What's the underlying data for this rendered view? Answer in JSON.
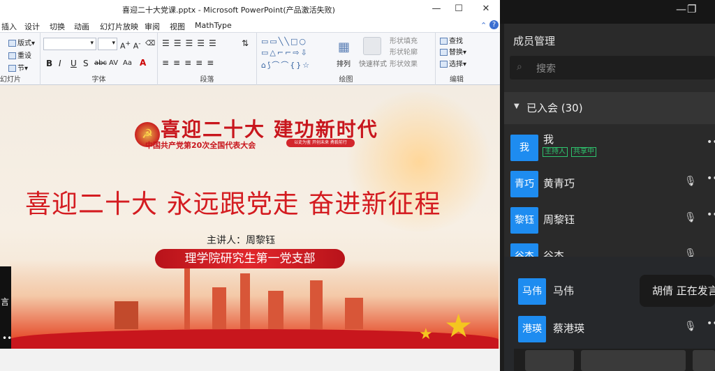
{
  "ppt": {
    "window_title": "喜迎二十大党课.pptx - Microsoft PowerPoint(产品激活失败)",
    "window_controls": {
      "minimize": "—",
      "maximize": "☐",
      "close": "✕"
    },
    "menu": [
      "插入",
      "设计",
      "切换",
      "动画",
      "幻灯片放映",
      "审阅",
      "视图",
      "MathType"
    ],
    "ribbon": {
      "slides_group": {
        "label": "幻灯片",
        "layout": "版式",
        "reset": "重设",
        "section": "节"
      },
      "font_group": {
        "label": "字体",
        "bold": "B",
        "italic": "I",
        "underline": "U",
        "shadow": "S",
        "strike": "abc",
        "spacing": "AV",
        "case": "Aa"
      },
      "paragraph_group": {
        "label": "段落"
      },
      "drawing_group": {
        "label": "绘图",
        "arrange": "排列",
        "quick_styles": "快速样式",
        "shape_fill": "形状填充",
        "shape_outline": "形状轮廓",
        "shape_effects": "形状效果"
      },
      "editing_group": {
        "label": "编辑",
        "find": "查找",
        "replace": "替换",
        "select": "选择"
      }
    },
    "slide": {
      "logo_title": "喜迎二十大 建功新时代",
      "logo_subtitle": "中国共产党第20次全国代表大会",
      "logo_tag": "以史为鉴 开创未来 勇毅前行",
      "headline": "喜迎二十大 永远跟党走 奋进新征程",
      "speaker": "主讲人：周黎钰",
      "org_banner": "理学院研究生第一党支部"
    },
    "left_strip_text": "言"
  },
  "meeting_panel": {
    "title": "成员管理",
    "search_placeholder": "搜索",
    "section_label": "已入会 (30)",
    "members": [
      {
        "avatar": "我",
        "name": "我",
        "tags": [
          "主持人",
          "共享中"
        ],
        "mic": ""
      },
      {
        "avatar": "青巧",
        "name": "黄青巧",
        "tags": [],
        "mic": "🎙"
      },
      {
        "avatar": "黎钰",
        "name": "周黎钰",
        "tags": [],
        "mic": "🎙"
      },
      {
        "avatar": "谷杰",
        "name": "谷杰",
        "tags": [],
        "mic": "🎙"
      },
      {
        "avatar": "马伟",
        "name": "马伟",
        "tags": [],
        "mic": ""
      },
      {
        "avatar": "港瑛",
        "name": "蔡港瑛",
        "tags": [],
        "mic": "🎙"
      }
    ],
    "toast": "胡倩 正在发言",
    "top_controls": {
      "minimize": "—",
      "restore": "❐"
    },
    "colors": {
      "accent": "#1e8cf0",
      "tag": "#2ec56e"
    }
  }
}
